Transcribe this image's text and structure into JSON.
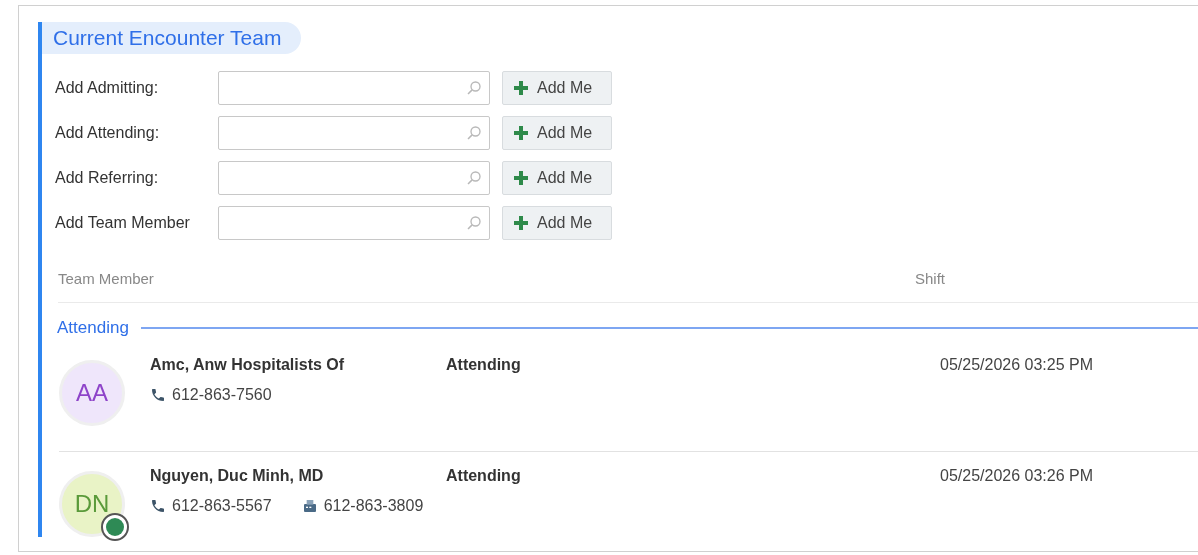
{
  "section": {
    "title": "Current Encounter Team"
  },
  "add_fields": [
    {
      "label": "Add Admitting:",
      "button": "Add Me"
    },
    {
      "label": "Add Attending:",
      "button": "Add Me"
    },
    {
      "label": "Add Referring:",
      "button": "Add Me"
    },
    {
      "label": "Add Team Member",
      "button": "Add Me"
    }
  ],
  "table": {
    "columns": [
      "Team Member",
      "Shift"
    ],
    "groups": [
      {
        "title": "Attending",
        "members": [
          {
            "initials": "AA",
            "color": "#8e44c9",
            "name": "Amc, Anw Hospitalists Of",
            "role": "Attending",
            "shift": "05/25/2026 03:25 PM",
            "presence": false,
            "contacts": [
              {
                "kind": "phone",
                "number": "612-863-7560"
              }
            ]
          },
          {
            "initials": "DN",
            "color": "#5a9a3a",
            "name": "Nguyen, Duc Minh, MD",
            "role": "Attending",
            "shift": "05/25/2026 03:26 PM",
            "presence": true,
            "contacts": [
              {
                "kind": "phone",
                "number": "612-863-5567"
              },
              {
                "kind": "fax",
                "number": "612-863-3809"
              }
            ]
          }
        ]
      }
    ]
  }
}
